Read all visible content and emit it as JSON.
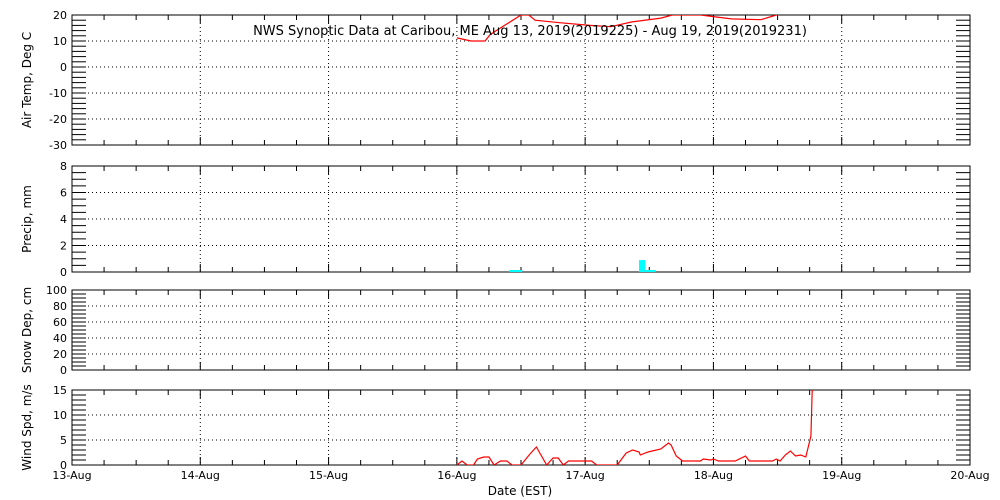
{
  "chart_data": [
    {
      "type": "line",
      "title": "NWS Synoptic Data at Caribou, ME   Aug 13, 2019(2019225) - Aug 19, 2019(2019231)",
      "ylabel": "Air Temp, Deg C",
      "ylim": [
        -30,
        20
      ],
      "yticks": [
        -30,
        -20,
        -10,
        0,
        10,
        20
      ],
      "minor_step": 2,
      "color": "#ff0000",
      "x_days": [
        3.0,
        3.11,
        3.22,
        3.26,
        3.5,
        3.56,
        3.61,
        3.81,
        4.04,
        4.2,
        4.36,
        4.59,
        4.68,
        4.9,
        5.14,
        5.37,
        5.49,
        5.6
      ],
      "y": [
        11.2,
        10,
        10,
        12.5,
        20,
        20,
        18,
        17,
        16,
        15.5,
        17.3,
        18.8,
        20,
        20,
        18.5,
        18.2,
        20,
        21
      ]
    },
    {
      "type": "bar",
      "ylabel": "Precip, mm",
      "ylim": [
        0,
        8
      ],
      "yticks": [
        0,
        2,
        4,
        6,
        8
      ],
      "minor_step": 0.5,
      "color": "#00ffff",
      "bars": [
        {
          "start_day": 3.41,
          "end_day": 3.51,
          "value": 0.15
        },
        {
          "start_day": 4.42,
          "end_day": 4.47,
          "value": 0.9
        },
        {
          "start_day": 4.47,
          "end_day": 4.55,
          "value": 0.15
        }
      ]
    },
    {
      "type": "line",
      "ylabel": "Snow Dep, cm",
      "ylim": [
        0,
        100
      ],
      "yticks": [
        0,
        20,
        40,
        60,
        80,
        100
      ],
      "minor_step": 5,
      "color": "#ff0000",
      "x_days": [],
      "y": []
    },
    {
      "type": "line",
      "ylabel": "Wind Spd, m/s",
      "ylim": [
        0,
        15
      ],
      "yticks": [
        0,
        5,
        10,
        15
      ],
      "minor_step": 1,
      "color": "#ff0000",
      "x_days": [
        3.0,
        3.04,
        3.08,
        3.13,
        3.16,
        3.21,
        3.25,
        3.29,
        3.34,
        3.39,
        3.43,
        3.5,
        3.57,
        3.62,
        3.7,
        3.75,
        3.79,
        3.83,
        3.87,
        4.05,
        4.09,
        4.25,
        4.32,
        4.37,
        4.42,
        4.43,
        4.49,
        4.59,
        4.65,
        4.67,
        4.71,
        4.76,
        4.9,
        4.92,
        4.98,
        5.0,
        5.04,
        5.17,
        5.25,
        5.28,
        5.46,
        5.49,
        5.52,
        5.56,
        5.6,
        5.64,
        5.68,
        5.72,
        5.76,
        5.77
      ],
      "y": [
        0,
        0.8,
        0,
        0,
        1.2,
        1.6,
        1.6,
        0,
        0.8,
        0.8,
        0,
        0,
        2.2,
        3.6,
        0,
        1.4,
        1.4,
        0,
        0.8,
        0.8,
        0,
        0,
        2.4,
        3,
        2.6,
        2,
        2.6,
        3.2,
        4.4,
        4,
        1.8,
        0.8,
        0.8,
        1.2,
        1,
        1.2,
        0.8,
        0.8,
        1.8,
        0.8,
        0.8,
        1.2,
        0.8,
        2,
        2.8,
        1.8,
        2,
        1.6,
        5.8,
        15
      ]
    }
  ],
  "x_axis": {
    "label": "Date (EST)",
    "ticks": [
      "13-Aug",
      "14-Aug",
      "15-Aug",
      "16-Aug",
      "17-Aug",
      "18-Aug",
      "19-Aug",
      "20-Aug"
    ],
    "range_days": [
      0,
      7
    ]
  }
}
